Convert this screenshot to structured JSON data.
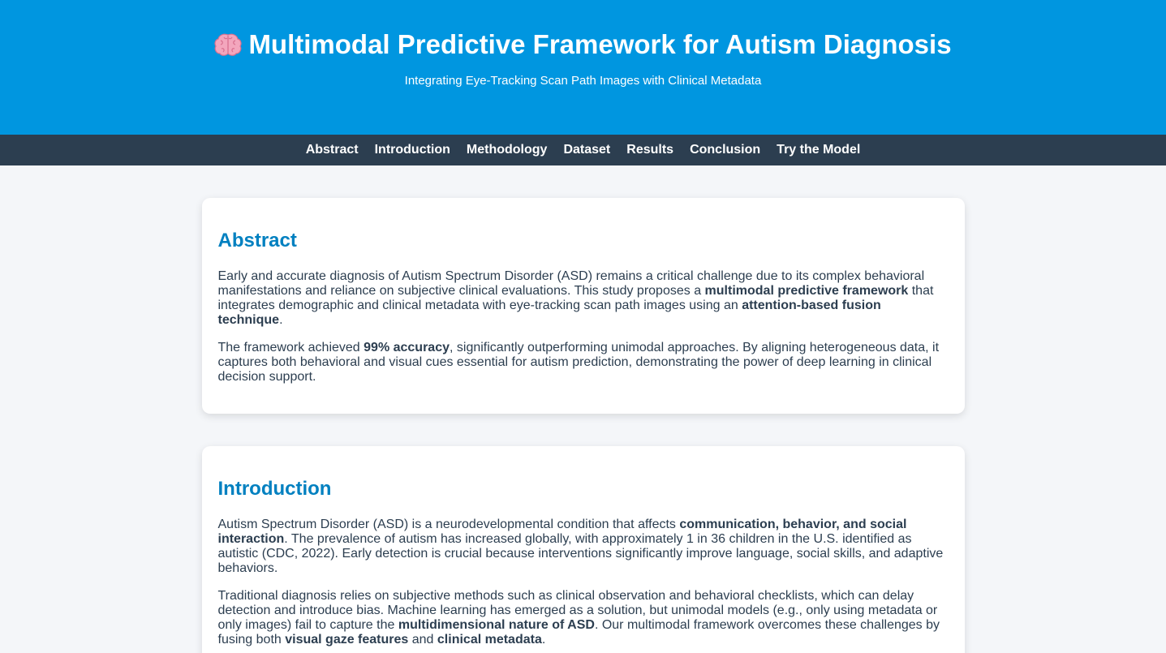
{
  "header": {
    "title": "Multimodal Predictive Framework for Autism Diagnosis",
    "icon": "brain-icon",
    "subtitle": "Integrating Eye-Tracking Scan Path Images with Clinical Metadata",
    "bg_color": "#0096e0"
  },
  "nav": {
    "bg_color": "#2c3e50",
    "items": [
      "Abstract",
      "Introduction",
      "Methodology",
      "Dataset",
      "Results",
      "Conclusion",
      "Try the Model"
    ]
  },
  "abstract": {
    "heading": "Abstract",
    "p1": {
      "a": "Early and accurate diagnosis of Autism Spectrum Disorder (ASD) remains a critical challenge due to its complex behavioral manifestations and reliance on subjective clinical evaluations. This study proposes a ",
      "b1": "multimodal predictive framework",
      "c": " that integrates demographic and clinical metadata with eye-tracking scan path images using an ",
      "b2": "attention-based fusion technique",
      "d": "."
    },
    "p2": {
      "a": "The framework achieved ",
      "b1": "99% accuracy",
      "c": ", significantly outperforming unimodal approaches. By aligning heterogeneous data, it captures both behavioral and visual cues essential for autism prediction, demonstrating the power of deep learning in clinical decision support."
    }
  },
  "introduction": {
    "heading": "Introduction",
    "p1": {
      "a": "Autism Spectrum Disorder (ASD) is a neurodevelopmental condition that affects ",
      "b1": "communication, behavior, and social interaction",
      "c": ". The prevalence of autism has increased globally, with approximately 1 in 36 children in the U.S. identified as autistic (CDC, 2022). Early detection is crucial because interventions significantly improve language, social skills, and adaptive behaviors."
    },
    "p2": {
      "a": "Traditional diagnosis relies on subjective methods such as clinical observation and behavioral checklists, which can delay detection and introduce bias. Machine learning has emerged as a solution, but unimodal models (e.g., only using metadata or only images) fail to capture the ",
      "b1": "multidimensional nature of ASD",
      "c": ". Our multimodal framework overcomes these challenges by fusing both ",
      "b2": "visual gaze features",
      "d": " and ",
      "b3": "clinical metadata",
      "e": "."
    }
  }
}
